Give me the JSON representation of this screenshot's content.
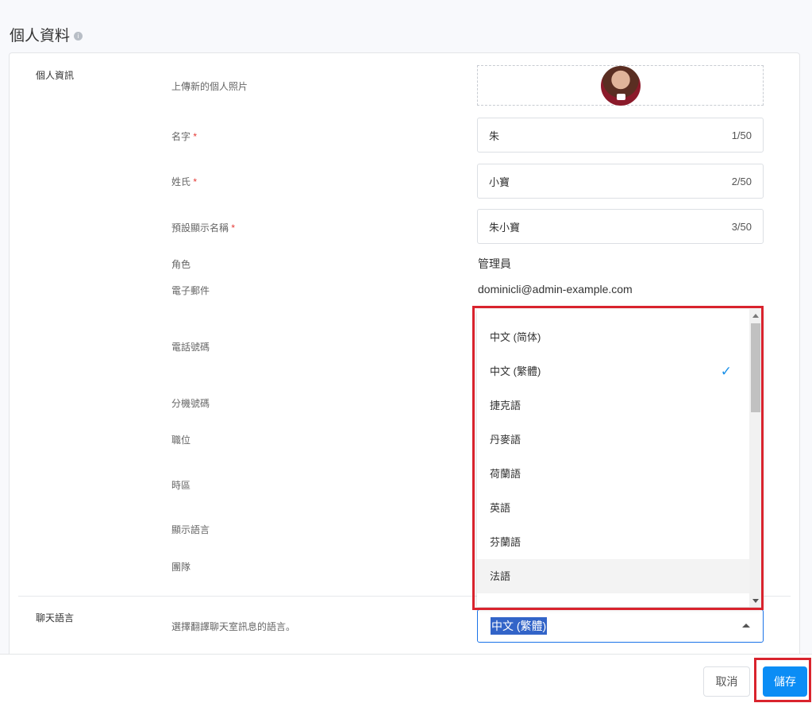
{
  "page": {
    "title": "個人資料",
    "info_icon": "info-icon"
  },
  "sections": {
    "personal": "個人資訊",
    "chat": "聊天語言"
  },
  "fields": {
    "photo": {
      "label": "上傳新的個人照片"
    },
    "first_name": {
      "label": "名字",
      "required": "*",
      "value": "朱",
      "count": "1/50"
    },
    "last_name": {
      "label": "姓氏",
      "required": "*",
      "value": "小寶",
      "count": "2/50"
    },
    "display_name": {
      "label": "預設顯示名稱",
      "required": "*",
      "value": "朱小寶",
      "count": "3/50"
    },
    "role": {
      "label": "角色",
      "value": "管理員"
    },
    "email": {
      "label": "電子郵件",
      "value": "dominicli@admin-example.com"
    },
    "phone": {
      "label": "電話號碼"
    },
    "extension": {
      "label": "分機號碼"
    },
    "job_title": {
      "label": "職位"
    },
    "timezone": {
      "label": "時區"
    },
    "display_language": {
      "label": "顯示語言"
    },
    "team": {
      "label": "團隊"
    },
    "chat_language": {
      "label": "選擇翻譯聊天室訊息的語言。",
      "value": "中文 (繁體)"
    }
  },
  "dropdown": {
    "options": [
      "中文 (简体)",
      "中文 (繁體)",
      "捷克語",
      "丹麥語",
      "荷蘭語",
      "英語",
      "芬蘭語",
      "法語"
    ],
    "selected": "中文 (繁體)",
    "check_icon": "✓"
  },
  "footer": {
    "cancel": "取消",
    "save": "儲存"
  },
  "colors": {
    "accent": "#0b8df5",
    "highlight": "#d9232d"
  }
}
